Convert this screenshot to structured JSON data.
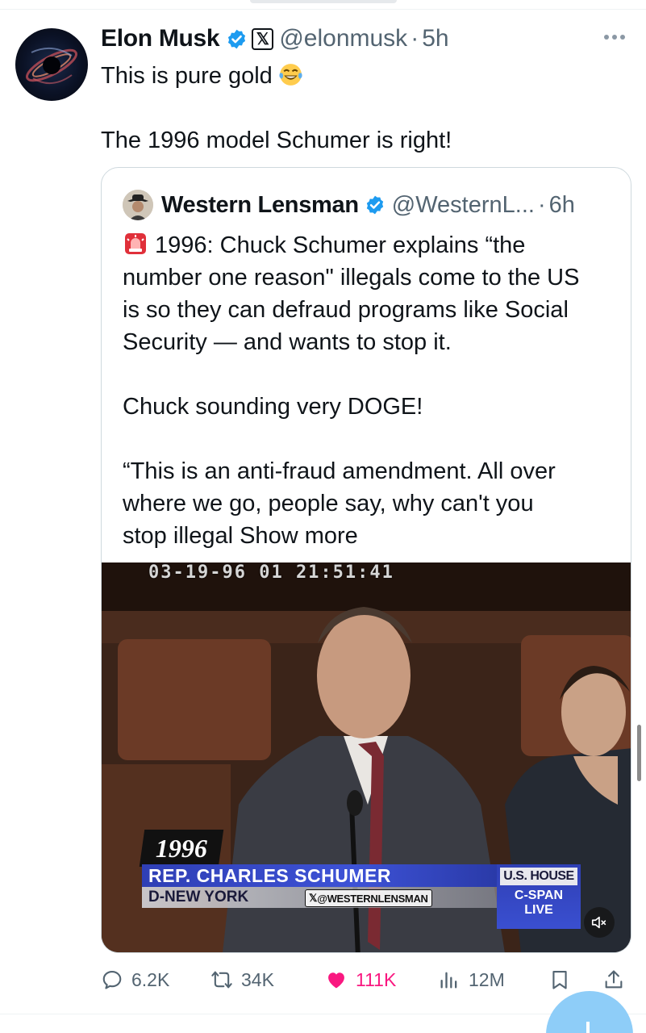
{
  "post": {
    "author_name": "Elon Musk",
    "handle": "@elonmusk",
    "separator": "·",
    "time": "5h",
    "avatar_icon": "black-hole-avatar",
    "text_lines": [
      "This is pure gold",
      "",
      "The 1996 model Schumer is right!"
    ],
    "emoji": "tears-of-joy-emoji"
  },
  "quote": {
    "author_name": "Western Lensman",
    "handle": "@WesternL...",
    "separator": "·",
    "time": "6h",
    "lines": [
      "1996: Chuck Schumer explains “the",
      "number one reason\" illegals come to the US",
      "is so they can defraud programs like Social",
      "Security — and wants to stop it.",
      "",
      "Chuck sounding very DOGE!",
      "",
      "“This is an anti-fraud amendment. All over",
      "where we go, people say, why can't you",
      "stop illegal"
    ],
    "show_more": "Show more",
    "video": {
      "timestamp": "03-19-96 01 21:51:41",
      "year": "1996",
      "name_caption": "REP. CHARLES SCHUMER",
      "district_caption": "D-NEW YORK",
      "watermark": "@WESTERNLENSMAN",
      "network_top": "U.S. HOUSE",
      "network_line1": "C-SPAN",
      "network_line2": "LIVE"
    }
  },
  "metrics": {
    "replies": "6.2K",
    "reposts": "34K",
    "likes": "111K",
    "views": "12M"
  },
  "colors": {
    "verified_blue": "#1d9bf0",
    "like_pink": "#f91880",
    "muted_text": "#536471"
  }
}
